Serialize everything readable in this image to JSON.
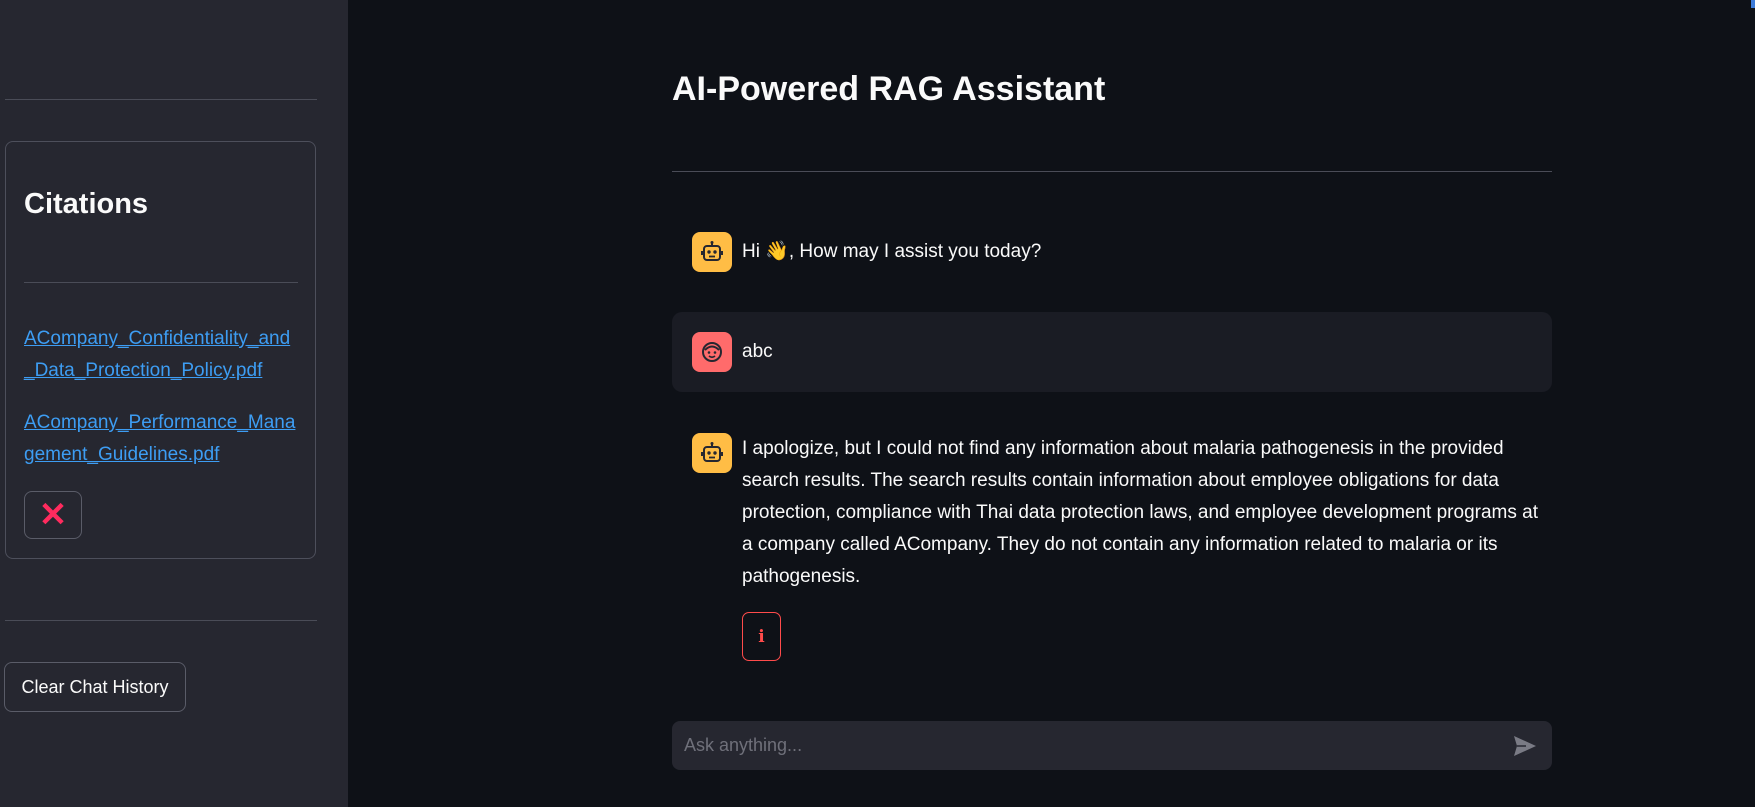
{
  "app": {
    "title": "AI-Powered RAG Assistant"
  },
  "sidebar": {
    "citations_title": "Citations",
    "citations": [
      {
        "label": "ACompany_Confidentiality_and_Data_Protection_Policy.pdf"
      },
      {
        "label": "ACompany_Performance_Management_Guidelines.pdf"
      }
    ],
    "close_label": "✕",
    "clear_button_label": "Clear Chat History"
  },
  "messages": [
    {
      "role": "assistant",
      "text": "Hi 👋, How may I assist you today?"
    },
    {
      "role": "user",
      "text": "abc"
    },
    {
      "role": "assistant",
      "text": "I apologize, but I could not find any information about malaria pathogenesis in the provided search results. The search results contain information about employee obligations for data protection, compliance with Thai data protection laws, and employee development programs at a company called ACompany. They do not contain any information related to malaria or its pathogenesis.",
      "info_label": "i"
    }
  ],
  "chat_input": {
    "placeholder": "Ask anything..."
  },
  "icons": {
    "bot": "robot-icon",
    "user": "face-icon",
    "send": "send-icon",
    "close": "close-icon",
    "info": "info-icon"
  },
  "colors": {
    "background": "#0e1117",
    "sidebar": "#262730",
    "link": "#3d9df3",
    "bot_avatar": "#ffbd45",
    "user_avatar": "#ff6b6b",
    "danger": "#ff4b4b"
  }
}
